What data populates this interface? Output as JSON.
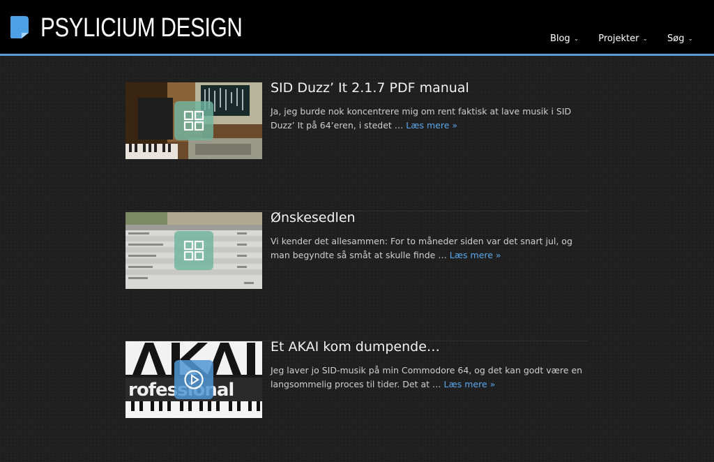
{
  "site": {
    "title": "PSYLICIUM DESIGN",
    "accent": "#5a9ad6",
    "link_color": "#5aa8ee"
  },
  "nav": {
    "items": [
      {
        "label": "Blog",
        "icon": "chevron-down-icon"
      },
      {
        "label": "Projekter",
        "icon": "chevron-down-icon"
      },
      {
        "label": "Søg",
        "icon": "chevron-down-icon"
      }
    ]
  },
  "posts": [
    {
      "title": "SID Duzz’ It 2.1.7 PDF manual",
      "excerpt": "Ja, jeg burde nok koncentrere mig om rent faktisk at lave musik i SID Duzz’ It på 64’eren, i stedet …",
      "read_more": "Læs mere »",
      "overlay_icon": "gallery-grid-icon"
    },
    {
      "title": "Ønskesedlen",
      "excerpt": "Vi kender det allesammen: For to måneder siden var det snart jul, og man begyndte så småt at skulle finde …",
      "read_more": "Læs mere »",
      "overlay_icon": "gallery-grid-icon"
    },
    {
      "title": "Et AKAI kom dumpende…",
      "excerpt": "Jeg laver jo SID-musik på min Commodore 64, og det kan godt være en langsommelig proces til tider. Det at …",
      "read_more": "Læs mere »",
      "overlay_icon": "video-play-icon"
    }
  ]
}
